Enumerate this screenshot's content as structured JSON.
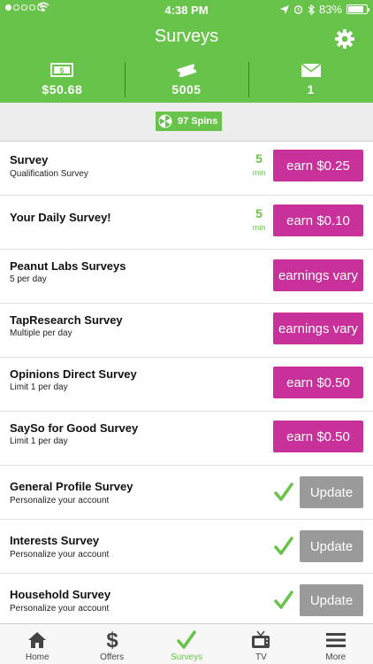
{
  "status_bar": {
    "time": "4:38 PM",
    "battery": "83%",
    "battery_level": 0.83
  },
  "header": {
    "title": "Surveys",
    "settings_icon": "gear-icon"
  },
  "stats": [
    {
      "icon": "cash-icon",
      "value": "$50.68"
    },
    {
      "icon": "ticket-icon",
      "value": "5005"
    },
    {
      "icon": "envelope-icon",
      "value": "1"
    }
  ],
  "spins": {
    "icon": "pinwheel-icon",
    "label": "97 Spins"
  },
  "surveys": [
    {
      "name": "Survey",
      "subtitle": "Qualification Survey",
      "minutes": "5",
      "minutes_unit": "min",
      "action": "earn $0.25"
    },
    {
      "name": "Your Daily Survey!",
      "subtitle": "",
      "minutes": "5",
      "minutes_unit": "min",
      "action": "earn $0.10"
    },
    {
      "name": "Peanut Labs Surveys",
      "subtitle": "5 per day",
      "action": "earnings vary"
    },
    {
      "name": "TapResearch Survey",
      "subtitle": "Multiple per day",
      "action": "earnings vary"
    },
    {
      "name": "Opinions Direct Survey",
      "subtitle": "Limit 1 per day",
      "action": "earn $0.50"
    },
    {
      "name": "SaySo for Good Survey",
      "subtitle": "Limit 1 per day",
      "action": "earn $0.50"
    },
    {
      "name": "General Profile Survey",
      "subtitle": "Personalize your account",
      "action": "Update"
    },
    {
      "name": "Interests Survey",
      "subtitle": "Personalize your account",
      "action": "Update"
    },
    {
      "name": "Household Survey",
      "subtitle": "Personalize your account",
      "action": "Update"
    }
  ],
  "tabs": [
    {
      "label": "Home",
      "icon": "home-icon"
    },
    {
      "label": "Offers",
      "icon": "dollar-icon"
    },
    {
      "label": "Surveys",
      "icon": "checkmark-icon",
      "active": true
    },
    {
      "label": "TV",
      "icon": "tv-icon"
    },
    {
      "label": "More",
      "icon": "menu-icon"
    }
  ],
  "colors": {
    "brand_green": "#68c34a",
    "earn_magenta": "#c8309a",
    "update_gray": "#9a9a9a"
  }
}
